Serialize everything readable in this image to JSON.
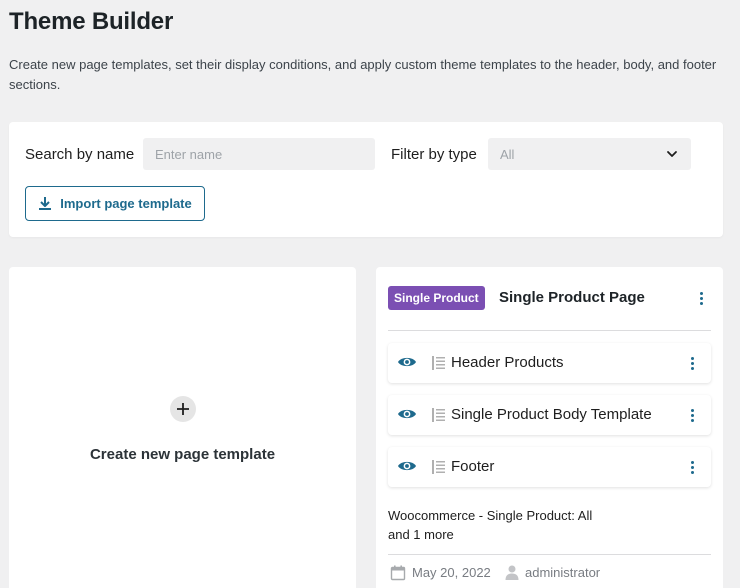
{
  "page": {
    "title": "Theme Builder",
    "description": "Create new page templates, set their display conditions, and apply custom theme templates to the header, body, and footer sections."
  },
  "filters": {
    "search_label": "Search by name",
    "search_placeholder": "Enter name",
    "search_value": "",
    "type_label": "Filter by type",
    "type_selected": "All",
    "import_button": "Import page template"
  },
  "create_card": {
    "label": "Create new page template"
  },
  "template_card": {
    "badge": "Single Product",
    "badge_color": "#7b4fb3",
    "title": "Single Product Page",
    "parts": [
      {
        "label": "Header Products",
        "icon": "eye-icon"
      },
      {
        "label": "Single Product Body Template",
        "icon": "eye-icon"
      },
      {
        "label": "Footer",
        "icon": "eye-icon"
      }
    ],
    "conditions_line1": "Woocommerce - Single Product: All",
    "conditions_line2": "and 1 more",
    "date": "May 20, 2022",
    "author": "administrator"
  },
  "colors": {
    "accent": "#1e6a8d",
    "background": "#f0f0f1"
  }
}
